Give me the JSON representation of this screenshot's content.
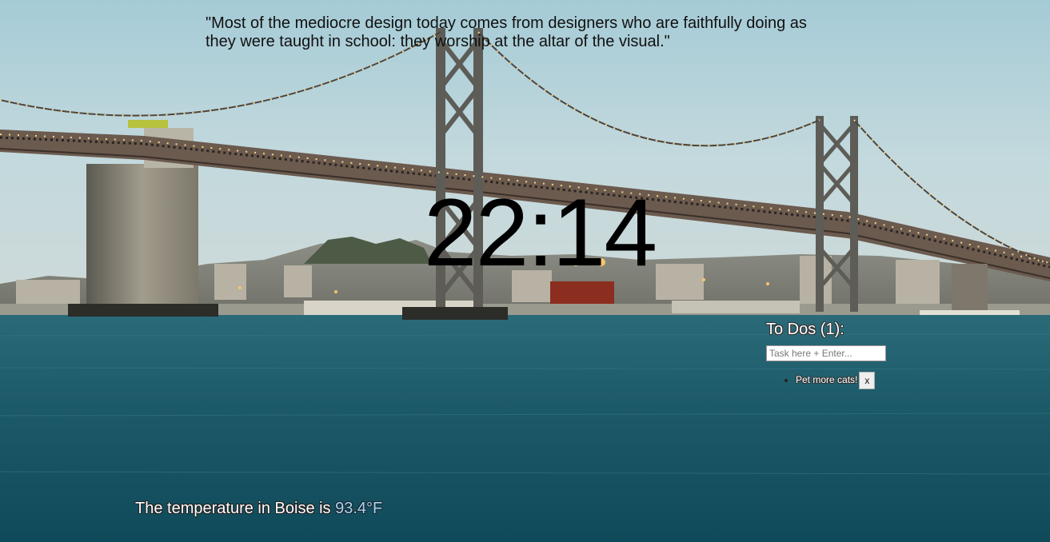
{
  "quote": {
    "text": "\"Most of the mediocre design today comes from designers who are faithfully doing as they were taught in school: they worship at the altar of the visual.\""
  },
  "clock": {
    "time": "22:14"
  },
  "todo": {
    "title": "To Dos (1):",
    "input_placeholder": "Task here + Enter...",
    "items": [
      {
        "text": "Pet more cats!",
        "remove_label": "x"
      }
    ]
  },
  "weather": {
    "prefix": "The temperature in Boise is ",
    "temperature": "93.4°F"
  },
  "background": {
    "image_name": "bay-bridge-photo",
    "sky_color": "#b9d6dd",
    "water_color": "#1d5a68"
  }
}
